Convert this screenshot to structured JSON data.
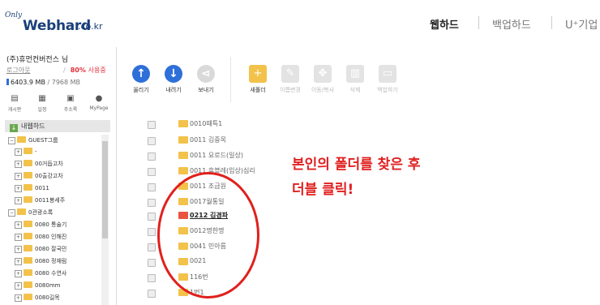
{
  "header": {
    "logo_small": "Only",
    "logo_brand": "Webhard",
    "logo_domain": ".co.kr",
    "nav": [
      "웹하드",
      "백업하드",
      "U⁺기업"
    ]
  },
  "account": {
    "company": "(주)휴먼컨버전스 님",
    "logout": "로그아웃",
    "usage_percent": "80%",
    "usage_label": "사용중",
    "quota_used": "6403.9 MB",
    "quota_total": "/ 7968 MB",
    "quota_fraction": 0.8
  },
  "quick_links": [
    "게시판",
    "일정",
    "주소록",
    "MyPage"
  ],
  "toolbar": {
    "upload": "올리기",
    "download": "내려기",
    "send": "보내기",
    "new_folder": "새폴더",
    "rename": "이름변경",
    "move_copy": "이동/복사",
    "delete": "삭제",
    "backup": "백업하기"
  },
  "tree": {
    "root": "내웹하드",
    "items": [
      "GUEST그룹",
      "-",
      "00거듭고차",
      "00출강고차",
      "0011",
      "0011봉세주",
      "0관광소록",
      "0080 통술기",
      "0080 인해진",
      "0080 잘국민",
      "0080 정재림",
      "0080 수연사",
      "0080mm",
      "0080길목"
    ]
  },
  "files": [
    {
      "name": "0010때특1"
    },
    {
      "name": "0011 김중목"
    },
    {
      "name": "0011 요로드(일상)"
    },
    {
      "name": "0011 휴블레(입상)심리"
    },
    {
      "name": "0011 조급원"
    },
    {
      "name": "0017월통일"
    },
    {
      "name": "0212 김경파",
      "selected": true
    },
    {
      "name": "0012명한명"
    },
    {
      "name": "0041 민아름"
    },
    {
      "name": "0021"
    },
    {
      "name": "116번"
    },
    {
      "name": "1번1"
    }
  ],
  "annotation": {
    "line1": "본인의 폴더를 찾은 후",
    "line2": "더블 클릭!"
  },
  "colors": {
    "brand": "#1a3f7a",
    "primary_button": "#2e6fd8",
    "folder": "#f2c24b",
    "annotation": "#e02020"
  }
}
